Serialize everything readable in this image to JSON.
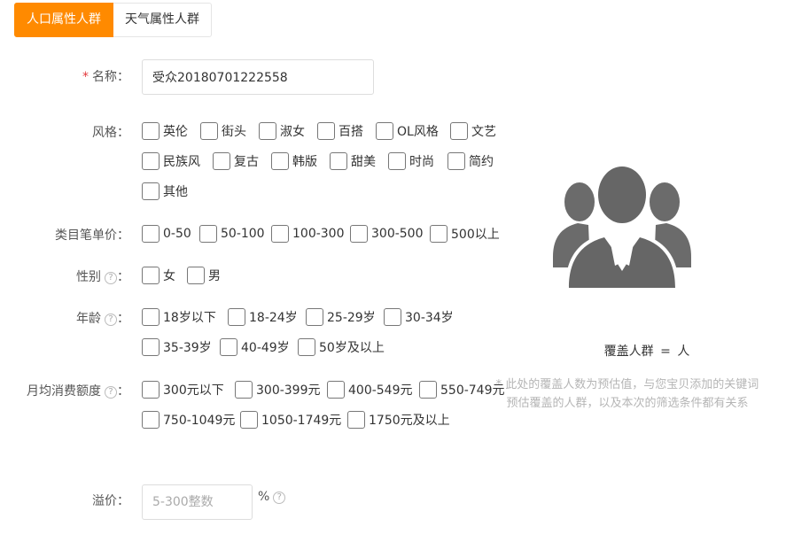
{
  "tabs": [
    {
      "label": "人口属性人群"
    },
    {
      "label": "天气属性人群"
    }
  ],
  "form": {
    "name": {
      "required_mark": "*",
      "label": "名称：",
      "value": "受众20180701222558"
    },
    "style": {
      "label": "风格：",
      "options": [
        "英伦",
        "街头",
        "淑女",
        "百搭",
        "OL风格",
        "文艺",
        "民族风",
        "复古",
        "韩版",
        "甜美",
        "时尚",
        "简约",
        "其他"
      ]
    },
    "price": {
      "label": "类目笔单价：",
      "options": [
        "0-50",
        "50-100",
        "100-300",
        "300-500",
        "500以上"
      ]
    },
    "gender": {
      "label": "性别",
      "colon": "：",
      "help": "?",
      "options": [
        "女",
        "男"
      ]
    },
    "age": {
      "label": "年龄",
      "colon": "：",
      "help": "?",
      "options": [
        "18岁以下",
        "18-24岁",
        "25-29岁",
        "30-34岁",
        "35-39岁",
        "40-49岁",
        "50岁及以上"
      ]
    },
    "spend": {
      "label": "月均消费额度",
      "colon": "：",
      "help": "?",
      "options": [
        "300元以下",
        "300-399元",
        "400-549元",
        "550-749元",
        "750-1049元",
        "1050-1749元",
        "1750元及以上"
      ]
    },
    "premium": {
      "label": "溢价：",
      "placeholder": "5-300整数",
      "unit": "%",
      "help": "?"
    }
  },
  "coverage": {
    "label": "覆盖人群",
    "equals": "=",
    "unit": "人",
    "note": "* 此处的覆盖人数为预估值，与您宝贝添加的关键词预估覆盖的人群，以及本次的筛选条件都有关系"
  },
  "icons": {
    "avatar": "people-group-icon",
    "help": "question-circle-icon"
  },
  "colors": {
    "accent": "#ff8a00",
    "required": "#e4393c",
    "avatar": "#666666",
    "note": "#b5b5b5"
  }
}
